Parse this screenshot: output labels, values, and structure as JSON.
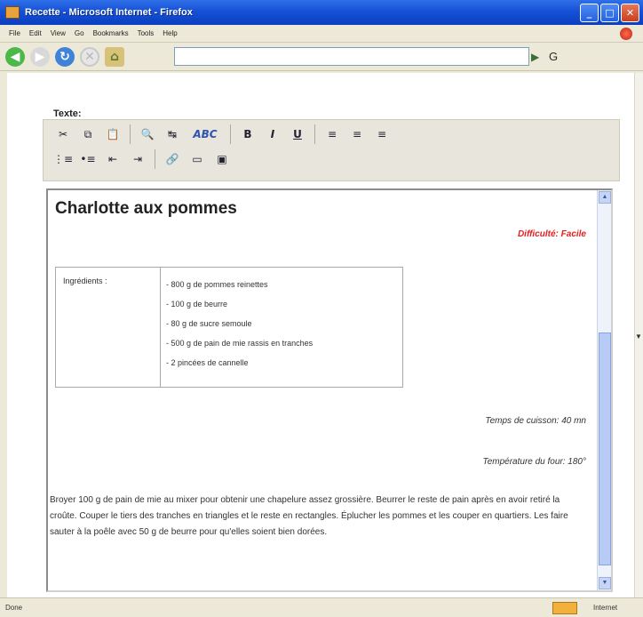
{
  "window": {
    "title": "Recette - Microsoft Internet - Firefox",
    "minimize_glyph": "_",
    "maximize_glyph": "□",
    "close_glyph": "✕"
  },
  "menu": {
    "items": [
      "File",
      "Edit",
      "View",
      "Go",
      "Bookmarks",
      "Tools",
      "Help"
    ]
  },
  "navbar": {
    "url": "",
    "icons": [
      "back-icon",
      "forward-icon",
      "reload-icon",
      "stop-icon",
      "home-icon",
      "go-icon",
      "search-icon"
    ]
  },
  "editor": {
    "group_label": "Texte:",
    "toolbar": {
      "cut": "✂",
      "copy": "⧉",
      "paste": "📋",
      "find": "🔍",
      "replace": "↹",
      "spellcheck": "ABC",
      "bold": "B",
      "italic": "I",
      "underline": "U",
      "align_left": "≡",
      "align_center": "≡",
      "align_right": "≡",
      "ordered_list": "⋮≡",
      "unordered_list": "•≡",
      "outdent": "⇤",
      "indent": "⇥",
      "link": "🔗",
      "table": "▭",
      "image": "▣"
    },
    "document": {
      "title": "Charlotte aux pommes",
      "difficulty": "Difficulté: Facile",
      "ingredients_label": "Ingrédients :",
      "ingredients": [
        "- 800 g de pommes reinettes",
        "- 100 g de beurre",
        "- 80 g de sucre semoule",
        "- 500 g de pain de mie rassis en tranches",
        "- 2 pincées de cannelle"
      ],
      "cooking_time": "Temps de cuisson: 40 mn",
      "oven_temperature": "Température du four: 180°",
      "instructions": "Broyer 100 g de pain de mie au mixer pour obtenir une chapelure assez grossière. Beurrer le reste de pain après en avoir retiré la croûte. Couper le tiers des tranches en triangles et le reste en rectangles. Éplucher les pommes et les couper en quartiers. Les faire sauter à la poêle avec 50 g de beurre pour qu'elles soient bien dorées."
    }
  },
  "status": {
    "text": "Done",
    "zone": "Internet"
  }
}
